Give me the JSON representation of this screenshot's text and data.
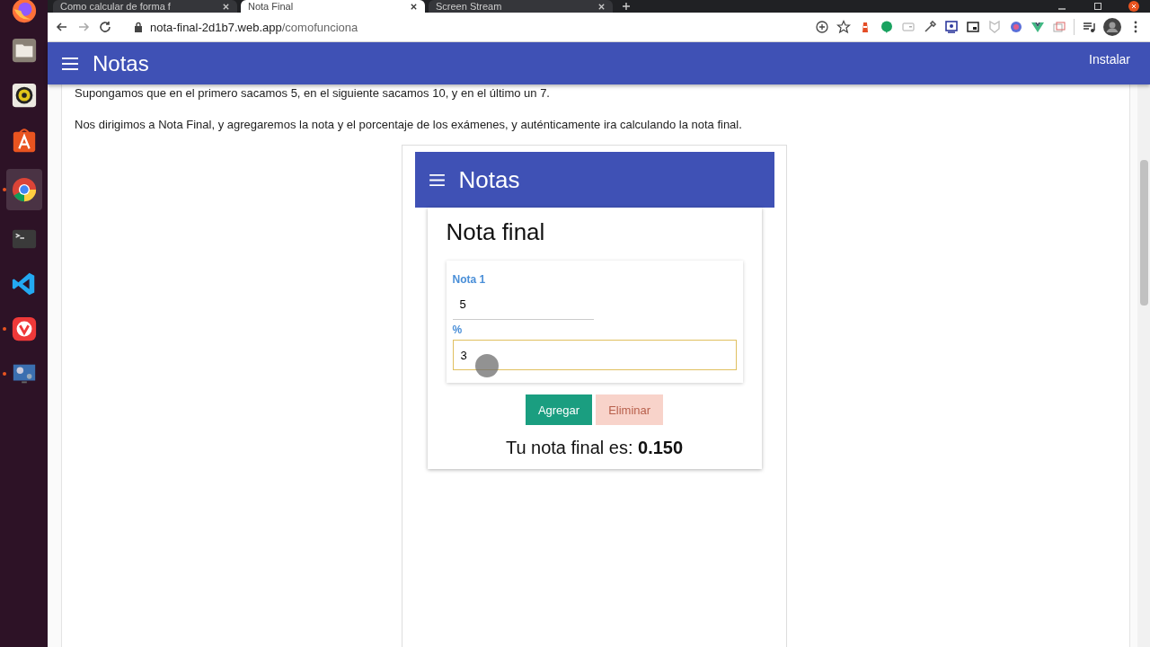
{
  "dock": [
    {
      "kind": "firefox",
      "selected": false,
      "running": false
    },
    {
      "kind": "files",
      "selected": false,
      "running": false
    },
    {
      "kind": "speaker",
      "selected": false,
      "running": false
    },
    {
      "kind": "store",
      "selected": false,
      "running": false
    },
    {
      "kind": "chrome",
      "selected": true,
      "running": true
    },
    {
      "kind": "terminal",
      "selected": false,
      "running": false
    },
    {
      "kind": "vscode",
      "selected": false,
      "running": false
    },
    {
      "kind": "vivaldi",
      "selected": false,
      "running": true
    },
    {
      "kind": "monitor",
      "selected": false,
      "running": true
    }
  ],
  "tabs": [
    {
      "title": "Como calcular de forma f",
      "selected": false
    },
    {
      "title": "Nota Final",
      "selected": true
    },
    {
      "title": "Screen Stream",
      "selected": false
    }
  ],
  "address": {
    "host": "nota-final-2d1b7.web.app",
    "path": "/comofunciona"
  },
  "app_bar": {
    "title": "Notas",
    "action": "Instalar"
  },
  "paragraphs": [
    "Supongamos que en el primero sacamos 5, en el siguiente sacamos 10, y en el último un 7.",
    "Nos dirigimos a Nota Final, y agregaremos la nota y el porcentaje de los exámenes, y auténticamente ira calculando la nota final."
  ],
  "preview": {
    "app_bar": {
      "title": "Notas"
    },
    "heading": "Nota final",
    "fields": [
      {
        "label": "Nota 1",
        "value": "5",
        "focused": false
      },
      {
        "label": "%",
        "value": "3",
        "focused": true
      }
    ],
    "buttons": [
      {
        "label": "Agregar",
        "disabled": false
      },
      {
        "label": "Eliminar",
        "disabled": true
      }
    ],
    "result": "Tu nota final es: **0.150**"
  }
}
